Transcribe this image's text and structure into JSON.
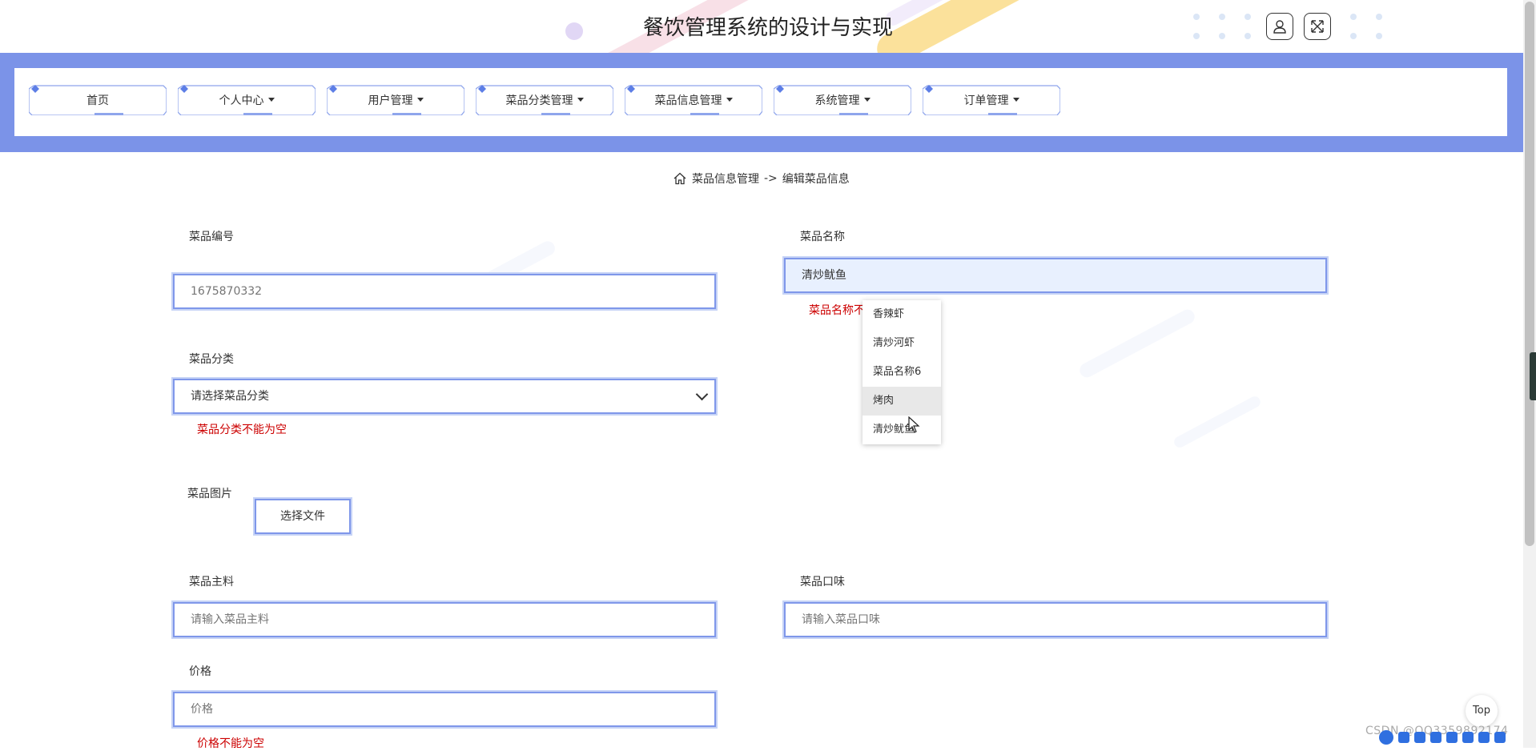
{
  "app": {
    "title": "餐饮管理系统的设计与实现"
  },
  "header": {
    "user_icon": "user-icon",
    "fullscreen_icon": "fullscreen-icon"
  },
  "nav": {
    "items": [
      {
        "label": "首页",
        "dropdown": false
      },
      {
        "label": "个人中心",
        "dropdown": true
      },
      {
        "label": "用户管理",
        "dropdown": true
      },
      {
        "label": "菜品分类管理",
        "dropdown": true
      },
      {
        "label": "菜品信息管理",
        "dropdown": true
      },
      {
        "label": "系统管理",
        "dropdown": true
      },
      {
        "label": "订单管理",
        "dropdown": true
      }
    ]
  },
  "breadcrumb": {
    "icon": "home-icon",
    "parent": "菜品信息管理",
    "separator": "->",
    "current": "编辑菜品信息"
  },
  "form": {
    "dish_no": {
      "label": "菜品编号",
      "value": "1675870332"
    },
    "dish_name": {
      "label": "菜品名称",
      "value": "清炒鱿鱼",
      "error": "菜品名称不"
    },
    "dish_category": {
      "label": "菜品分类",
      "placeholder": "请选择菜品分类",
      "error": "菜品分类不能为空"
    },
    "dish_image": {
      "label": "菜品图片",
      "button": "选择文件"
    },
    "dish_ingredients": {
      "label": "菜品主料",
      "placeholder": "请输入菜品主料"
    },
    "dish_flavor": {
      "label": "菜品口味",
      "placeholder": "请输入菜品口味"
    },
    "price": {
      "label": "价格",
      "placeholder": "价格",
      "error": "价格不能为空"
    }
  },
  "autocomplete": {
    "options": [
      "香辣虾",
      "清炒河虾",
      "菜品名称6",
      "烤肉",
      "清炒鱿鱼"
    ],
    "hovered": "烤肉"
  },
  "top_button": "Top",
  "watermark": "CSDN @QQ3359892174",
  "colors": {
    "nav_band": "#7b93e8",
    "input_border": "#7f97ea",
    "error": "#cc0000"
  }
}
